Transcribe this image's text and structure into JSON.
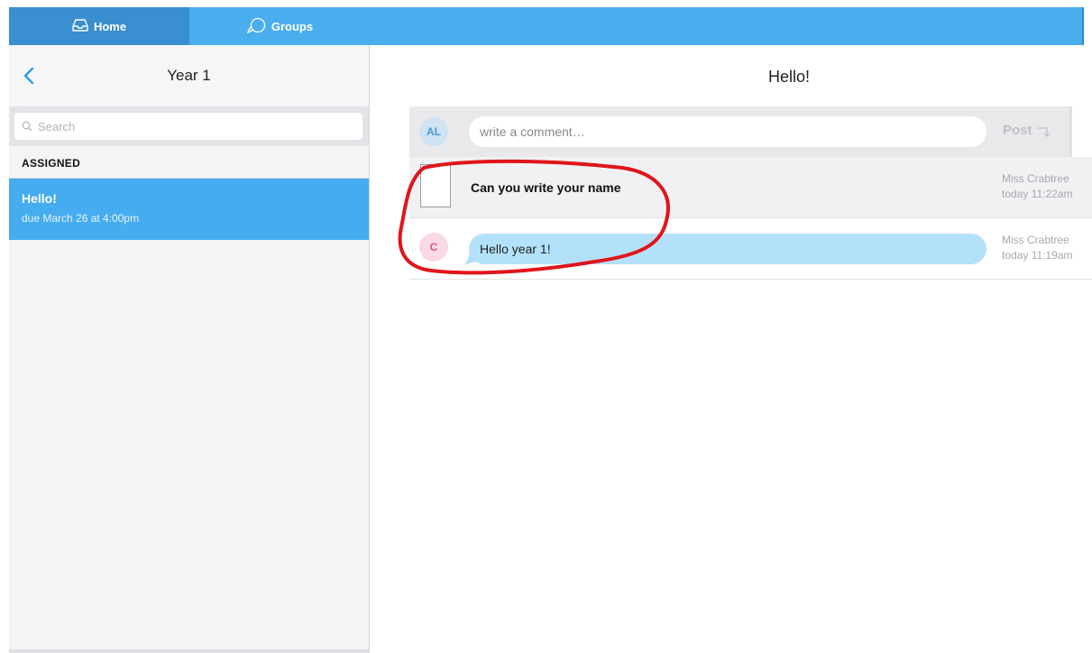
{
  "topbar": {
    "tabs": [
      {
        "label": "Home",
        "icon": "inbox-icon"
      },
      {
        "label": "Groups",
        "icon": "chat-bubble-icon"
      }
    ],
    "accent": "#4aaeee"
  },
  "sidebar": {
    "title": "Year 1",
    "search": {
      "placeholder": "Search",
      "value": ""
    },
    "section_label": "ASSIGNED",
    "items": [
      {
        "title": "Hello!",
        "due": "due March 26 at 4:00pm"
      }
    ]
  },
  "main": {
    "title": "Hello!",
    "composer": {
      "avatar_initials": "AL",
      "placeholder": "write a comment…",
      "post_label": "Post"
    },
    "feed": [
      {
        "type": "assignment",
        "text": "Can you write your name",
        "author": "Miss Crabtree",
        "time": "today 11:22am"
      },
      {
        "type": "message",
        "avatar_initials": "C",
        "text": "Hello year 1!",
        "author": "Miss Crabtree",
        "time": "today 11:19am"
      }
    ]
  },
  "colors": {
    "selected_item": "#45acef",
    "annotation": "#e0151b",
    "bubble": "#b4e1fa"
  }
}
